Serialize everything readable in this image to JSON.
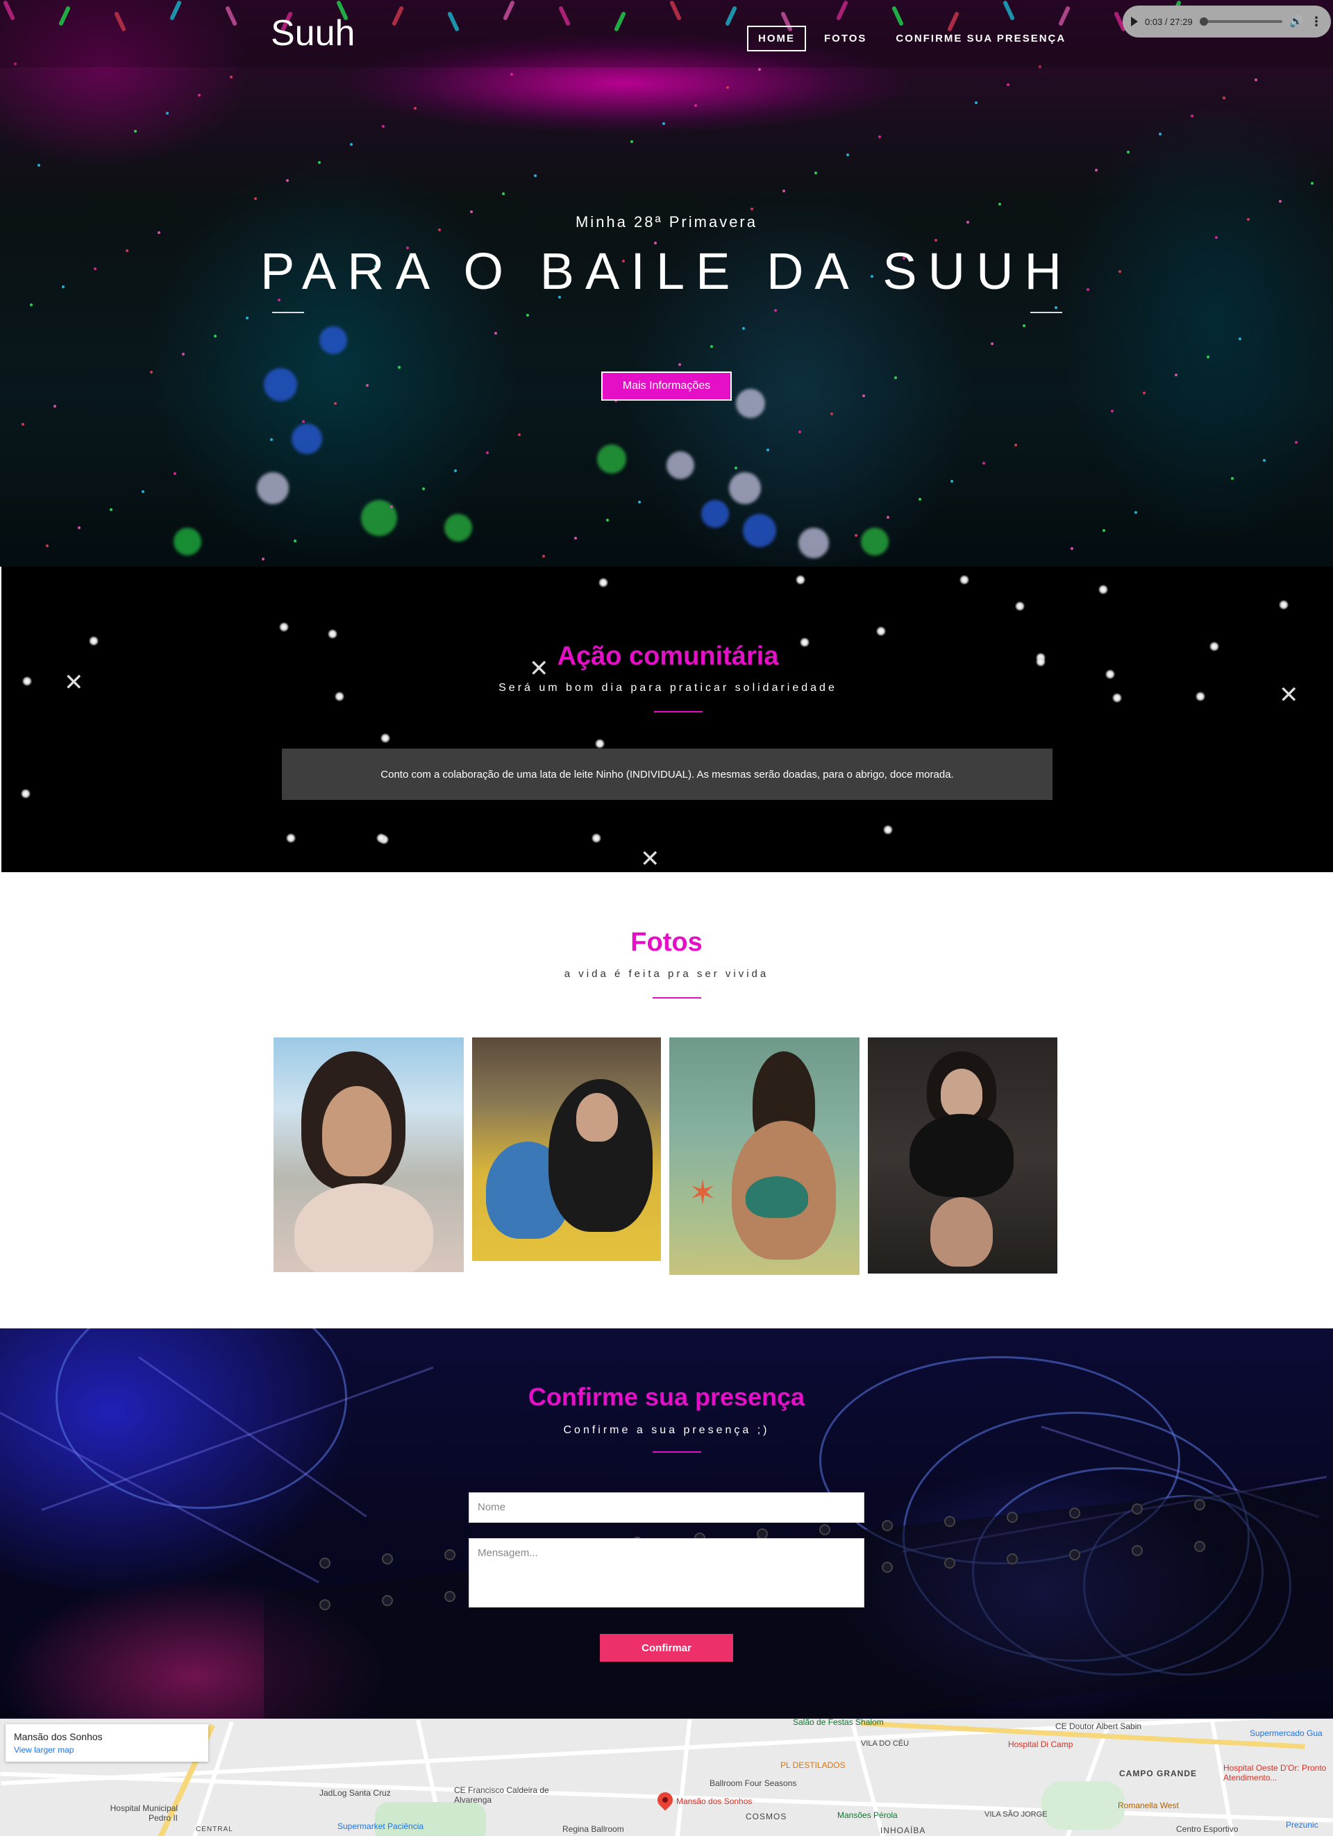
{
  "header": {
    "logo": "Suuh",
    "nav": [
      {
        "label": "HOME",
        "active": true
      },
      {
        "label": "FOTOS",
        "active": false
      },
      {
        "label": "CONFIRME SUA PRESENÇA",
        "active": false
      }
    ]
  },
  "audio_player": {
    "time": "0:03 / 27:29",
    "progress_fraction": 0.002,
    "icons": [
      "play-icon",
      "volume-icon",
      "more-options-icon"
    ]
  },
  "hero": {
    "eyebrow": "Minha 28ª Primavera",
    "title": "PARA O BAILE DA SUUH",
    "button_label": "Mais Informações",
    "accent": "#e40fc6"
  },
  "acao": {
    "title": "Ação comunitária",
    "subtitle": "Será um bom dia para praticar solidariedade",
    "note": "Conto com a colaboração de uma lata de leite Ninho (INDIVIDUAL). As mesmas serão doadas, para o abrigo, doce morada."
  },
  "fotos": {
    "title": "Fotos",
    "subtitle": "a vida é feita pra ser vivida"
  },
  "confirme": {
    "title": "Confirme sua presença",
    "subtitle": "Confirme a sua presença ;)",
    "name_placeholder": "Nome",
    "message_placeholder": "Mensagem...",
    "submit_label": "Confirmar",
    "button_color": "#ed2f6a"
  },
  "map": {
    "place_name": "Mansão dos Sonhos",
    "link": "View larger map",
    "labels": [
      "CE Doutor Albert Sabin",
      "Supermercado Gua",
      "Hospital Di Camp",
      "CAMPO GRANDE",
      "Hospital Oeste D'Or: Pronto Atendimento...",
      "Romanella West",
      "Centro Esportivo",
      "Prezunic",
      "PL DESTILADOS",
      "Ballroom Four Seasons",
      "Mansão dos Sonhos",
      "Mansões Pérola",
      "COSMOS",
      "INHOAÍBA",
      "VILA DO CÉU",
      "VILA SÃO JORGE",
      "JadLog Santa Cruz",
      "CE Francisco Caldeira de Alvarenga",
      "Hospital Municipal Pedro II",
      "Supermarket Paciência",
      "Regina Ballroom",
      "CENTRAL",
      "Salão de Festas Shalom"
    ]
  }
}
